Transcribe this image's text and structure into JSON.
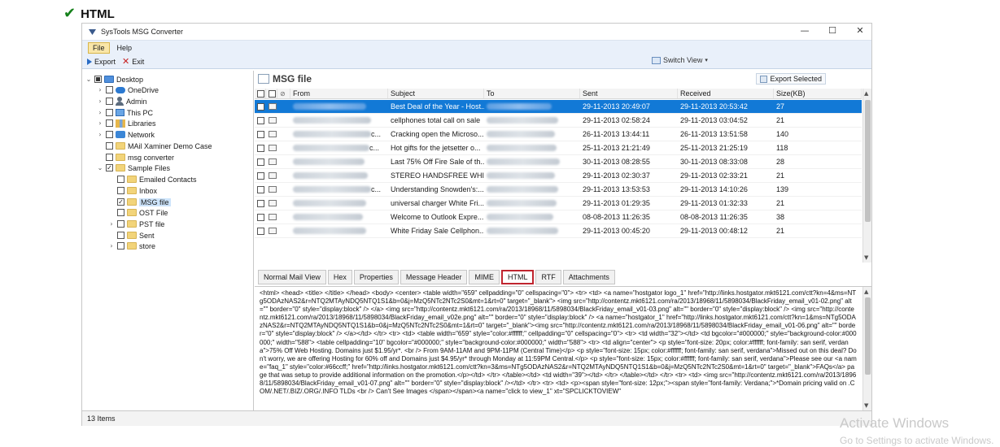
{
  "caption": "HTML",
  "window": {
    "title": "SysTools MSG Converter",
    "controls": [
      "—",
      "☐",
      "✕"
    ]
  },
  "menu": {
    "items": [
      "File",
      "Help"
    ]
  },
  "toolbar": {
    "export": "Export",
    "exit": "Exit",
    "switch_view": "Switch View"
  },
  "sidebar": {
    "items": [
      {
        "label": "Desktop",
        "icon": "folder-blue-icon",
        "expander": "expanded",
        "checkbox": "partial"
      },
      {
        "label": "OneDrive",
        "icon": "cloud-icon",
        "expander": "collapsed",
        "checkbox": "empty"
      },
      {
        "label": "Admin",
        "icon": "user-icon",
        "expander": "collapsed",
        "checkbox": "empty"
      },
      {
        "label": "This PC",
        "icon": "pc-icon",
        "expander": "collapsed",
        "checkbox": "empty"
      },
      {
        "label": "Libraries",
        "icon": "library-icon",
        "expander": "collapsed",
        "checkbox": "empty"
      },
      {
        "label": "Network",
        "icon": "network-icon",
        "expander": "collapsed",
        "checkbox": "empty"
      },
      {
        "label": "MAil Xaminer Demo Case",
        "icon": "folder-icon",
        "expander": "none",
        "checkbox": "empty"
      },
      {
        "label": "msg converter",
        "icon": "folder-icon",
        "expander": "none",
        "checkbox": "empty"
      },
      {
        "label": "Sample Files",
        "icon": "folder-icon",
        "expander": "expanded",
        "checkbox": "checked"
      },
      {
        "label": "Emailed Contacts",
        "icon": "folder-icon",
        "expander": "none",
        "checkbox": "empty"
      },
      {
        "label": "Inbox",
        "icon": "folder-icon",
        "expander": "none",
        "checkbox": "empty"
      },
      {
        "label": "MSG file",
        "icon": "folder-icon",
        "expander": "none",
        "checkbox": "checked",
        "selected": true
      },
      {
        "label": "OST File",
        "icon": "folder-icon",
        "expander": "none",
        "checkbox": "empty"
      },
      {
        "label": "PST file",
        "icon": "folder-icon",
        "expander": "collapsed",
        "checkbox": "empty"
      },
      {
        "label": "Sent",
        "icon": "folder-icon",
        "expander": "none",
        "checkbox": "empty"
      },
      {
        "label": "store",
        "icon": "folder-icon",
        "expander": "collapsed",
        "checkbox": "empty"
      }
    ]
  },
  "status": {
    "items_count": "13 Items"
  },
  "main": {
    "title": "MSG file",
    "export_selected": "Export Selected",
    "columns": [
      "From",
      "Subject",
      "To",
      "Sent",
      "Received",
      "Size(KB)"
    ],
    "rows": [
      {
        "from_suffix": "",
        "subject": "Best Deal of the Year - Host...",
        "sent": "29-11-2013 20:49:07",
        "received": "29-11-2013 20:53:42",
        "size": "27",
        "selected": true
      },
      {
        "from_suffix": "",
        "subject": "cellphones total call on sale",
        "sent": "29-11-2013 02:58:24",
        "received": "29-11-2013 03:04:52",
        "size": "21"
      },
      {
        "from_suffix": "c...",
        "subject": "Cracking open the Microso...",
        "sent": "26-11-2013 13:44:11",
        "received": "26-11-2013 13:51:58",
        "size": "140"
      },
      {
        "from_suffix": "c...",
        "subject": "Hot gifts for the jetsetter o...",
        "sent": "25-11-2013 21:21:49",
        "received": "25-11-2013 21:25:19",
        "size": "118"
      },
      {
        "from_suffix": "",
        "subject": "Last 75% Off Fire Sale of th...",
        "sent": "30-11-2013 08:28:55",
        "received": "30-11-2013 08:33:08",
        "size": "28"
      },
      {
        "from_suffix": "",
        "subject": "STEREO HANDSFREE WHIT...",
        "sent": "29-11-2013 02:30:37",
        "received": "29-11-2013 02:33:21",
        "size": "21"
      },
      {
        "from_suffix": "c...",
        "subject": "Understanding Snowden's:...",
        "sent": "29-11-2013 13:53:53",
        "received": "29-11-2013 14:10:26",
        "size": "139"
      },
      {
        "from_suffix": "",
        "subject": "universal charger White Fri...",
        "sent": "29-11-2013 01:29:35",
        "received": "29-11-2013 01:32:33",
        "size": "21"
      },
      {
        "from_suffix": "",
        "subject": "Welcome to Outlook Expre...",
        "sent": "08-08-2013 11:26:35",
        "received": "08-08-2013 11:26:35",
        "size": "38"
      },
      {
        "from_suffix": "",
        "subject": "White Friday Sale Cellphon...",
        "sent": "29-11-2013 00:45:20",
        "received": "29-11-2013 00:48:12",
        "size": "21"
      }
    ],
    "tabs": [
      "Normal Mail View",
      "Hex",
      "Properties",
      "Message Header",
      "MIME",
      "HTML",
      "RTF",
      "Attachments"
    ],
    "active_tab": "HTML",
    "html_source": "<html> <head>      <title> </title>      </head>      <body> <center>          <table width=\"659\" cellpadding=\"0\" cellspacing=\"0\">                                    <tr>                 <td> <a name=\"hostgator logo_1\"  href=\"http://links.hostgator.mkt6121.com/ctt?kn=4&ms=NTg5ODAzNAS2&r=NTQ2MTAyNDQ5NTQ1S1&b=0&j=MzQ5NTc2NTc2S0&mt=1&rt=0\" target=\"_blank\"> <img src=\"http://contentz.mkt6121.com/ra/2013/18968/11/5898034/BlackFriday_email_v01-02.png\"      alt=\"\" border=\"0\" style=\"display:block\" /> </a>    <img src=\"http://contentz.mkt6121.com/ra/2013/18968/11/5898034/BlackFriday_email_v01-03.png\"    alt=\"\" border=\"0\" style=\"display:block\" /> <img src=\"http://contentz.mkt6121.com/ra/2013/18968/11/5898034/BlackFriday_email_v02e.png\"     alt=\"\" border=\"0\" style=\"display:block\" /> <a name=\"hostgator_1\" href=\"http://links.hostgator.mkt6121.com/ctt?kn=1&ms=NTg5ODAzNAS2&r=NTQ2MTAyNDQ5NTQ1S1&b=0&j=MzQ5NTc2NTc2S0&mt=1&rt=0\" target=\"_blank\"><img src=\"http://contentz.mkt6121.com/ra/2013/18968/11/5898034/BlackFriday_email_v01-06.png\"     alt=\"\" border=\"0\" style=\"display:block\" /> </a></td>           </tr>          <tr>                 <td> <table width=\"659\" style=\"color:#ffffff;\" cellpadding=\"0\" cellspacing=\"0\">                                  <tr>                         <td width=\"32\"></td>                         <td bgcolor=\"#000000;\" style=\"background-color:#000000;\" width=\"588\"> <table cellpadding=\"10\" bgcolor=\"#000000;\" style=\"background-color:#000000;\" width=\"588\">                               <tr>                                    <td align=\"center\"> <p style=\"font-size: 20px; color:#ffffff; font-family: san serif, verdana\">75% Off Web Hosting. Domains just $1.95/yr*. <br />                                   From 9AM-11AM and 9PM-11PM (Central Time)</p>                                  <p style=\"font-size: 15px; color:#ffffff; font-family: san serif, verdana\">Missed out on this deal? Don't worry, we are offering Hosting for 60% off and Domains just $4.95/yr* through Monday at 11:59PM Central.</p>                                   <p style=\"font-size: 15px; color:#ffffff; font-family: san serif, verdana\">Please see our <a name=\"faq_1\" style=\"color:#66ccff;\"  href=\"http://links.hostgator.mkt6121.com/ctt?kn=3&ms=NTg5ODAzNAS2&r=NTQ2MTAyNDQ5NTQ1S1&b=0&j=MzQ5NTc2NTc2S0&mt=1&rt=0\" target=\"_blank\">FAQs</a> page that was setup to provide additional information on the promotion.</p></td>                         </tr>                                    </table></td>                         <td width=\"39\"></td>                 </tr>          </table></td>          </tr>                   <tr>                 <td> <img src=\"http://contentz.mkt6121.com/ra/2013/18968/11/5898034/BlackFriday_email_v01-07.png\"    alt=\"\" border=\"0\" style=\"display:block\" /></td>          </tr>                   <tr>             <td>          <p><span style=\"font-size: 12px;\"><span style=\"font-family: Verdana;\">*Domain pricing valid on .COM/.NET/.BIZ/.ORG/.INFO TLDs <br />        Can't See Images </span></span><a name=\"click to view_1\" xt=\"SPCLICKTOVIEW\""
  },
  "watermark": {
    "title": "Activate Windows",
    "subtitle": "Go to Settings to activate Windows."
  },
  "colors": {
    "selection": "#1279d6",
    "active_tab_border": "#c0252f",
    "toolbar_bg": "#e9f0fa"
  }
}
